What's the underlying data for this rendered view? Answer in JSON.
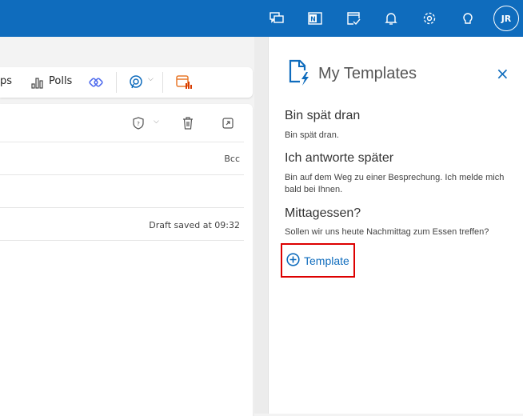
{
  "topbar": {
    "icons": [
      "chat-feedback-icon",
      "onenote-icon",
      "calendar-check-icon",
      "bell-icon",
      "gear-icon",
      "lightbulb-icon"
    ],
    "avatar": "JR",
    "color": "#0f6cbd"
  },
  "toolbar": {
    "apps_partial": "ps",
    "polls": "Polls"
  },
  "compose": {
    "bcc": "Bcc",
    "draft_status": "Draft saved at 09:32"
  },
  "panel": {
    "title": "My Templates",
    "templates": [
      {
        "name": "Bin spät dran",
        "body": "Bin spät dran."
      },
      {
        "name": "Ich antworte später",
        "body": "Bin auf dem Weg zu einer Besprechung. Ich melde mich bald bei Ihnen."
      },
      {
        "name": "Mittagessen?",
        "body": "Sollen wir uns heute Nachmittag zum Essen treffen?"
      }
    ],
    "add_label": "Template"
  }
}
